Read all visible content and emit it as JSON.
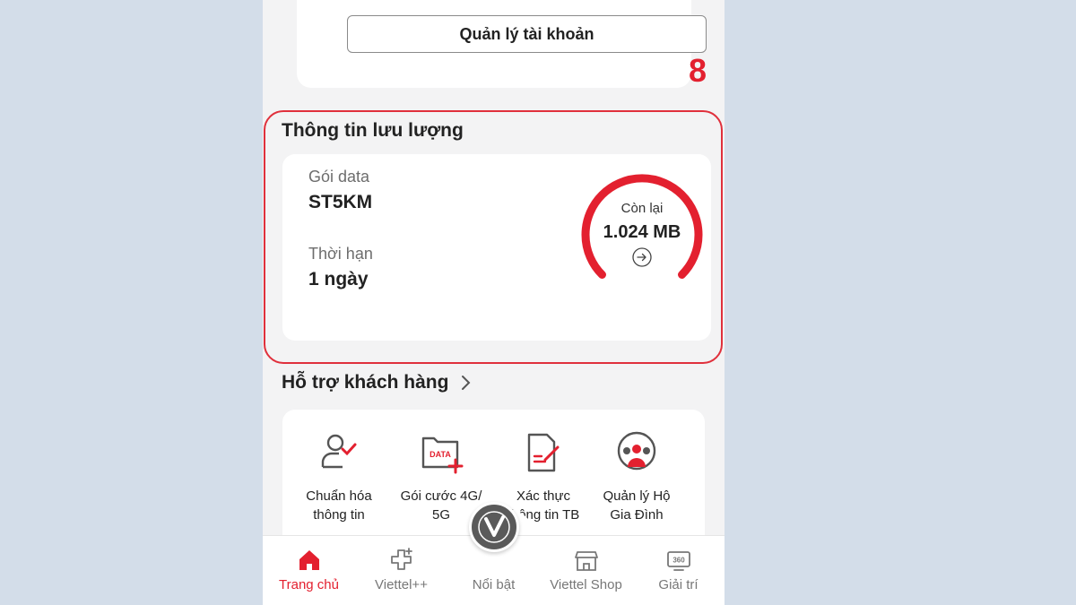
{
  "account": {
    "manage_button": "Quản lý tài khoản"
  },
  "annotation": {
    "step": "8"
  },
  "traffic": {
    "title": "Thông tin lưu lượng",
    "package_label": "Gói data",
    "package_value": "ST5KM",
    "duration_label": "Thời hạn",
    "duration_value": "1 ngày",
    "remaining_label": "Còn lại",
    "remaining_value": "1.024 MB",
    "remaining_fraction": 1.0
  },
  "support": {
    "title": "Hỗ trợ khách hàng",
    "items": [
      {
        "label": "Chuẩn hóa\nthông tin",
        "icon": "user-check-icon"
      },
      {
        "label": "Gói cước 4G/\n5G",
        "icon": "data-folder-icon"
      },
      {
        "label": "Xác thực\nthông tin TB",
        "icon": "document-edit-icon"
      },
      {
        "label": "Quản lý Hộ\nGia Đình",
        "icon": "family-icon"
      }
    ],
    "data_badge": "DATA"
  },
  "nav": {
    "items": [
      {
        "label": "Trang chủ",
        "icon": "home-icon",
        "active": true
      },
      {
        "label": "Viettel++",
        "icon": "plus-cross-icon",
        "active": false
      },
      {
        "label": "Nổi bật",
        "icon": "viettel-logo-icon",
        "active": false
      },
      {
        "label": "Viettel Shop",
        "icon": "shop-icon",
        "active": false
      },
      {
        "label": "Giải trí",
        "icon": "tv-360-icon",
        "active": false
      }
    ],
    "tv_badge": "360"
  },
  "colors": {
    "accent": "#e3202f",
    "highlight_border": "#e0303c"
  }
}
